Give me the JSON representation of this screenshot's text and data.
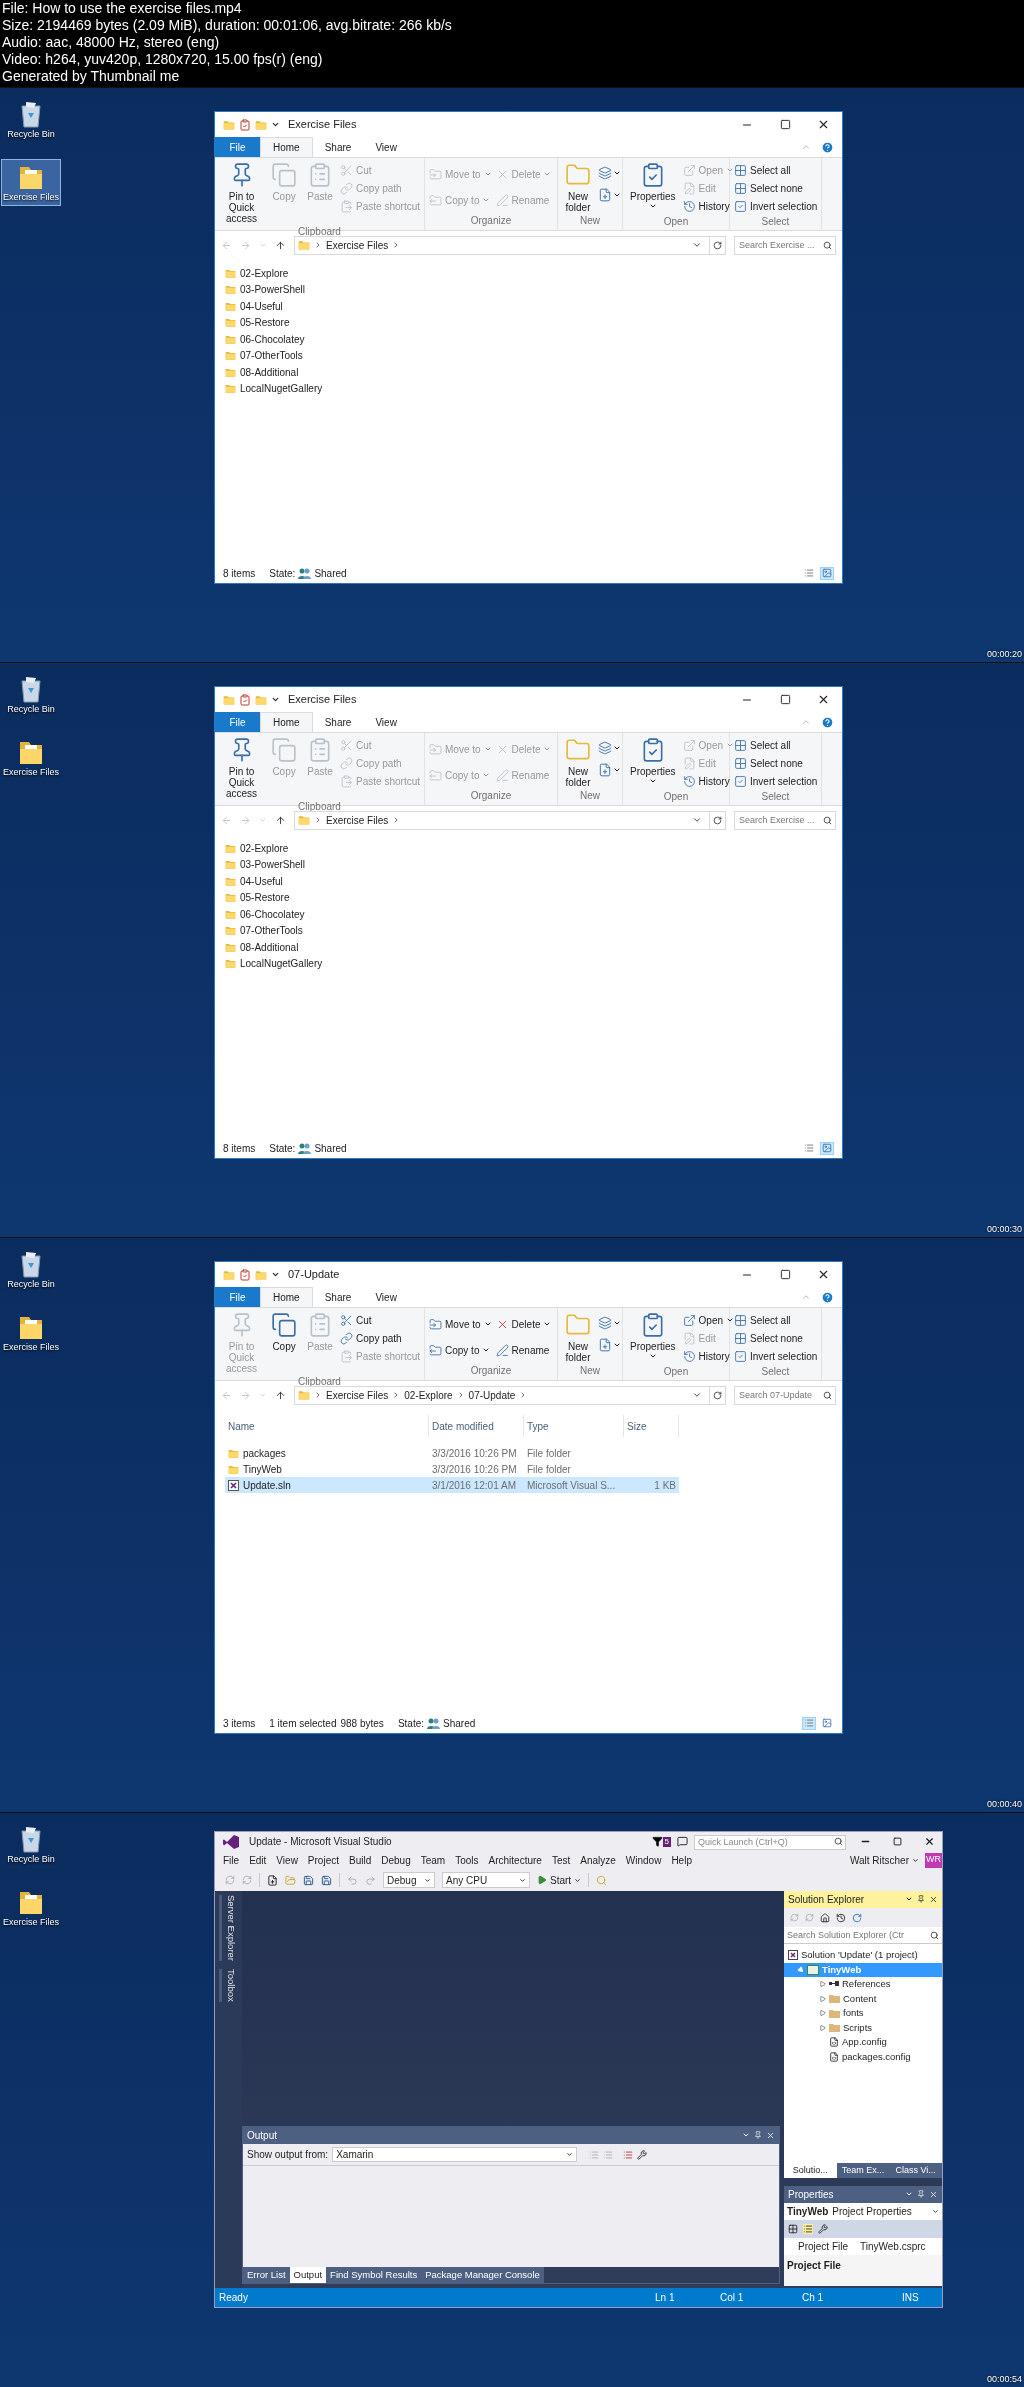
{
  "header": {
    "lines": [
      "File: How to use the exercise files.mp4",
      "Size: 2194469 bytes (2.09 MiB), duration: 00:01:06, avg.bitrate: 266 kb/s",
      "Audio: aac, 48000 Hz, stereo (eng)",
      "Video: h264, yuv420p, 1280x720, 15.00 fps(r) (eng)",
      "Generated by Thumbnail me"
    ]
  },
  "frames": [
    {
      "kind": "explorer",
      "timestamp": "00:00:20",
      "desktop_icons": [
        {
          "label": "Recycle Bin",
          "kind": "bin",
          "selected": false
        },
        {
          "label": "Exercise Files",
          "kind": "folder",
          "selected": true
        }
      ],
      "window": {
        "title": "Exercise Files",
        "tabs": [
          {
            "label": "File",
            "kind": "file",
            "selected": false
          },
          {
            "label": "Home",
            "kind": "tab",
            "selected": true
          },
          {
            "label": "Share",
            "kind": "tab",
            "selected": false
          },
          {
            "label": "View",
            "kind": "tab",
            "selected": false
          }
        ],
        "ribbon": [
          {
            "label": "Clipboard",
            "items": [
              {
                "label": "Pin to Quick access",
                "kind": "large",
                "disabled": false
              },
              {
                "label": "Copy",
                "kind": "large",
                "disabled": true
              },
              {
                "label": "Paste",
                "kind": "large",
                "disabled": true
              },
              {
                "label": "Cut",
                "kind": "small",
                "disabled": true
              },
              {
                "label": "Copy path",
                "kind": "small",
                "disabled": true
              },
              {
                "label": "Paste shortcut",
                "kind": "small",
                "disabled": true
              }
            ]
          },
          {
            "label": "Organize",
            "items": [
              {
                "label": "Move to",
                "kind": "small",
                "disabled": true,
                "menu": true
              },
              {
                "label": "Copy to",
                "kind": "small",
                "disabled": true,
                "menu": true
              },
              {
                "label": "Delete",
                "kind": "small",
                "disabled": true,
                "menu": true
              },
              {
                "label": "Rename",
                "kind": "small",
                "disabled": true
              }
            ]
          },
          {
            "label": "New",
            "items": [
              {
                "label": "New folder",
                "kind": "large",
                "disabled": false
              },
              {
                "kind": "icon",
                "disabled": false,
                "menu": true
              },
              {
                "kind": "icon",
                "disabled": false,
                "menu": true
              }
            ]
          },
          {
            "label": "Open",
            "items": [
              {
                "label": "Properties",
                "kind": "large",
                "disabled": false,
                "menu": true
              },
              {
                "label": "Open",
                "kind": "small",
                "disabled": true,
                "menu": true
              },
              {
                "label": "Edit",
                "kind": "small",
                "disabled": true
              },
              {
                "label": "History",
                "kind": "small",
                "disabled": false
              }
            ]
          },
          {
            "label": "Select",
            "items": [
              {
                "label": "Select all",
                "kind": "small",
                "disabled": false
              },
              {
                "label": "Select none",
                "kind": "small",
                "disabled": false
              },
              {
                "label": "Invert selection",
                "kind": "small",
                "disabled": false
              }
            ]
          }
        ],
        "path": [
          "Exercise Files"
        ],
        "search": {
          "placeholder": "Search Exercise ..."
        },
        "content": {
          "kind": "list",
          "items": [
            {
              "name": "02-Explore"
            },
            {
              "name": "03-PowerShell"
            },
            {
              "name": "04-Useful"
            },
            {
              "name": "05-Restore"
            },
            {
              "name": "06-Chocolatey"
            },
            {
              "name": "07-OtherTools"
            },
            {
              "name": "08-Additional"
            },
            {
              "name": "LocalNugetGallery"
            }
          ]
        },
        "status": {
          "items": "8 items",
          "state_label": "State:",
          "state": "Shared"
        },
        "view_buttons": [
          {
            "selected": false
          },
          {
            "selected": true
          }
        ]
      }
    },
    {
      "kind": "explorer",
      "timestamp": "00:00:30",
      "desktop_icons": [
        {
          "label": "Recycle Bin",
          "kind": "bin",
          "selected": false
        },
        {
          "label": "Exercise Files",
          "kind": "folder",
          "selected": false
        }
      ],
      "window": {
        "title": "Exercise Files",
        "tabs": [
          {
            "label": "File",
            "kind": "file",
            "selected": false
          },
          {
            "label": "Home",
            "kind": "tab",
            "selected": true
          },
          {
            "label": "Share",
            "kind": "tab",
            "selected": false
          },
          {
            "label": "View",
            "kind": "tab",
            "selected": false
          }
        ],
        "ribbon": [
          {
            "label": "Clipboard",
            "items": [
              {
                "label": "Pin to Quick access",
                "kind": "large",
                "disabled": false
              },
              {
                "label": "Copy",
                "kind": "large",
                "disabled": true
              },
              {
                "label": "Paste",
                "kind": "large",
                "disabled": true
              },
              {
                "label": "Cut",
                "kind": "small",
                "disabled": true
              },
              {
                "label": "Copy path",
                "kind": "small",
                "disabled": true
              },
              {
                "label": "Paste shortcut",
                "kind": "small",
                "disabled": true
              }
            ]
          },
          {
            "label": "Organize",
            "items": [
              {
                "label": "Move to",
                "kind": "small",
                "disabled": true,
                "menu": true
              },
              {
                "label": "Copy to",
                "kind": "small",
                "disabled": true,
                "menu": true
              },
              {
                "label": "Delete",
                "kind": "small",
                "disabled": true,
                "menu": true
              },
              {
                "label": "Rename",
                "kind": "small",
                "disabled": true
              }
            ]
          },
          {
            "label": "New",
            "items": [
              {
                "label": "New folder",
                "kind": "large",
                "disabled": false
              },
              {
                "kind": "icon",
                "disabled": false,
                "menu": true
              },
              {
                "kind": "icon",
                "disabled": false,
                "menu": true
              }
            ]
          },
          {
            "label": "Open",
            "items": [
              {
                "label": "Properties",
                "kind": "large",
                "disabled": false,
                "menu": true
              },
              {
                "label": "Open",
                "kind": "small",
                "disabled": true,
                "menu": true
              },
              {
                "label": "Edit",
                "kind": "small",
                "disabled": true
              },
              {
                "label": "History",
                "kind": "small",
                "disabled": false
              }
            ]
          },
          {
            "label": "Select",
            "items": [
              {
                "label": "Select all",
                "kind": "small",
                "disabled": false
              },
              {
                "label": "Select none",
                "kind": "small",
                "disabled": false
              },
              {
                "label": "Invert selection",
                "kind": "small",
                "disabled": false
              }
            ]
          }
        ],
        "path": [
          "Exercise Files"
        ],
        "search": {
          "placeholder": "Search Exercise ..."
        },
        "content": {
          "kind": "list",
          "items": [
            {
              "name": "02-Explore"
            },
            {
              "name": "03-PowerShell"
            },
            {
              "name": "04-Useful"
            },
            {
              "name": "05-Restore"
            },
            {
              "name": "06-Chocolatey"
            },
            {
              "name": "07-OtherTools"
            },
            {
              "name": "08-Additional"
            },
            {
              "name": "LocalNugetGallery"
            }
          ]
        },
        "status": {
          "items": "8 items",
          "state_label": "State:",
          "state": "Shared"
        },
        "view_buttons": [
          {
            "selected": false
          },
          {
            "selected": true
          }
        ]
      }
    },
    {
      "kind": "explorer",
      "timestamp": "00:00:40",
      "desktop_icons": [
        {
          "label": "Recycle Bin",
          "kind": "bin",
          "selected": false
        },
        {
          "label": "Exercise Files",
          "kind": "folder",
          "selected": false
        }
      ],
      "window": {
        "title": "07-Update",
        "tabs": [
          {
            "label": "File",
            "kind": "file",
            "selected": false
          },
          {
            "label": "Home",
            "kind": "tab",
            "selected": true
          },
          {
            "label": "Share",
            "kind": "tab",
            "selected": false
          },
          {
            "label": "View",
            "kind": "tab",
            "selected": false
          }
        ],
        "ribbon": [
          {
            "label": "Clipboard",
            "items": [
              {
                "label": "Pin to Quick access",
                "kind": "large",
                "disabled": true
              },
              {
                "label": "Copy",
                "kind": "large",
                "disabled": false
              },
              {
                "label": "Paste",
                "kind": "large",
                "disabled": true
              },
              {
                "label": "Cut",
                "kind": "small",
                "disabled": false
              },
              {
                "label": "Copy path",
                "kind": "small",
                "disabled": false
              },
              {
                "label": "Paste shortcut",
                "kind": "small",
                "disabled": true
              }
            ]
          },
          {
            "label": "Organize",
            "items": [
              {
                "label": "Move to",
                "kind": "small",
                "disabled": false,
                "menu": true
              },
              {
                "label": "Copy to",
                "kind": "small",
                "disabled": false,
                "menu": true
              },
              {
                "label": "Delete",
                "kind": "small",
                "disabled": false,
                "menu": true
              },
              {
                "label": "Rename",
                "kind": "small",
                "disabled": false
              }
            ]
          },
          {
            "label": "New",
            "items": [
              {
                "label": "New folder",
                "kind": "large",
                "disabled": false
              },
              {
                "kind": "icon",
                "disabled": false,
                "menu": true
              },
              {
                "kind": "icon",
                "disabled": false,
                "menu": true
              }
            ]
          },
          {
            "label": "Open",
            "items": [
              {
                "label": "Properties",
                "kind": "large",
                "disabled": false,
                "menu": true
              },
              {
                "label": "Open",
                "kind": "small",
                "disabled": false,
                "menu": true
              },
              {
                "label": "Edit",
                "kind": "small",
                "disabled": true
              },
              {
                "label": "History",
                "kind": "small",
                "disabled": false
              }
            ]
          },
          {
            "label": "Select",
            "items": [
              {
                "label": "Select all",
                "kind": "small",
                "disabled": false
              },
              {
                "label": "Select none",
                "kind": "small",
                "disabled": false
              },
              {
                "label": "Invert selection",
                "kind": "small",
                "disabled": false
              }
            ]
          }
        ],
        "path": [
          "Exercise Files",
          "02-Explore",
          "07-Update"
        ],
        "search": {
          "placeholder": "Search 07-Update"
        },
        "content": {
          "kind": "details",
          "columns": [
            "Name",
            "Date modified",
            "Type",
            "Size"
          ],
          "items": [
            {
              "name": "packages",
              "date": "3/3/2016 10:26 PM",
              "type": "File folder",
              "kind": "folder",
              "selected": false
            },
            {
              "name": "TinyWeb",
              "date": "3/3/2016 10:26 PM",
              "type": "File folder",
              "kind": "folder",
              "selected": false
            },
            {
              "name": "Update.sln",
              "date": "3/1/2016 12:01 AM",
              "type": "Microsoft Visual S...",
              "size": "1 KB",
              "kind": "solution",
              "selected": true
            }
          ]
        },
        "status": {
          "items": "3 items",
          "selection": "1 item selected",
          "size": "988 bytes",
          "state_label": "State:",
          "state": "Shared"
        },
        "view_buttons": [
          {
            "selected": true
          },
          {
            "selected": false
          }
        ]
      }
    },
    {
      "kind": "vs",
      "timestamp": "00:00:54",
      "desktop_icons": [
        {
          "label": "Recycle Bin",
          "kind": "bin",
          "selected": false
        },
        {
          "label": "Exercise Files",
          "kind": "folder",
          "selected": false
        }
      ],
      "window": {
        "title": "Update - Microsoft Visual Studio",
        "notifications": "5",
        "quick_launch": {
          "placeholder": "Quick Launch (Ctrl+Q)"
        },
        "menu": [
          "File",
          "Edit",
          "View",
          "Project",
          "Build",
          "Debug",
          "Team",
          "Tools",
          "Architecture",
          "Test",
          "Analyze",
          "Window",
          "Help"
        ],
        "user": "Walt Ritscher",
        "avatar": "WR",
        "toolbar": {
          "configuration": "Debug",
          "platform": "Any CPU",
          "start": "Start"
        },
        "side_tabs": [
          "Server Explorer",
          "Toolbox"
        ],
        "solution_explorer": {
          "title": "Solution Explorer",
          "search": {
            "placeholder": "Search Solution Explorer (Ctr"
          },
          "tree": [
            {
              "label": "Solution 'Update' (1 project)",
              "kind": "solution",
              "selected": false,
              "children": [
                {
                  "label": "TinyWeb",
                  "kind": "project",
                  "selected": true,
                  "expanded": true,
                  "children": [
                    {
                      "label": "References",
                      "kind": "references",
                      "selected": false,
                      "expanded": false
                    },
                    {
                      "label": "Content",
                      "kind": "folder",
                      "selected": false,
                      "expanded": false
                    },
                    {
                      "label": "fonts",
                      "kind": "folder",
                      "selected": false,
                      "expanded": false
                    },
                    {
                      "label": "Scripts",
                      "kind": "folder",
                      "selected": false,
                      "expanded": false
                    },
                    {
                      "label": "App.config",
                      "kind": "config",
                      "selected": false
                    },
                    {
                      "label": "packages.config",
                      "kind": "config",
                      "selected": false
                    }
                  ]
                }
              ]
            }
          ],
          "tabs": [
            {
              "label": "Solutio...",
              "selected": true
            },
            {
              "label": "Team Ex...",
              "selected": false
            },
            {
              "label": "Class Vi...",
              "selected": false
            }
          ]
        },
        "properties": {
          "title": "Properties",
          "object": "TinyWeb",
          "object_type": "Project Properties",
          "rows": [
            {
              "name": "Project File",
              "value": "TinyWeb.csprc"
            }
          ],
          "description": "Project File"
        },
        "output": {
          "title": "Output",
          "source_label": "Show output from:",
          "source": "Xamarin",
          "tabs": [
            {
              "label": "Error List",
              "selected": false
            },
            {
              "label": "Output",
              "selected": true
            },
            {
              "label": "Find Symbol Results",
              "selected": false
            },
            {
              "label": "Package Manager Console",
              "selected": false
            }
          ]
        },
        "status_bar": {
          "message": "Ready",
          "line": "Ln 1",
          "column": "Col 1",
          "char": "Ch 1",
          "mode": "INS"
        }
      }
    }
  ]
}
